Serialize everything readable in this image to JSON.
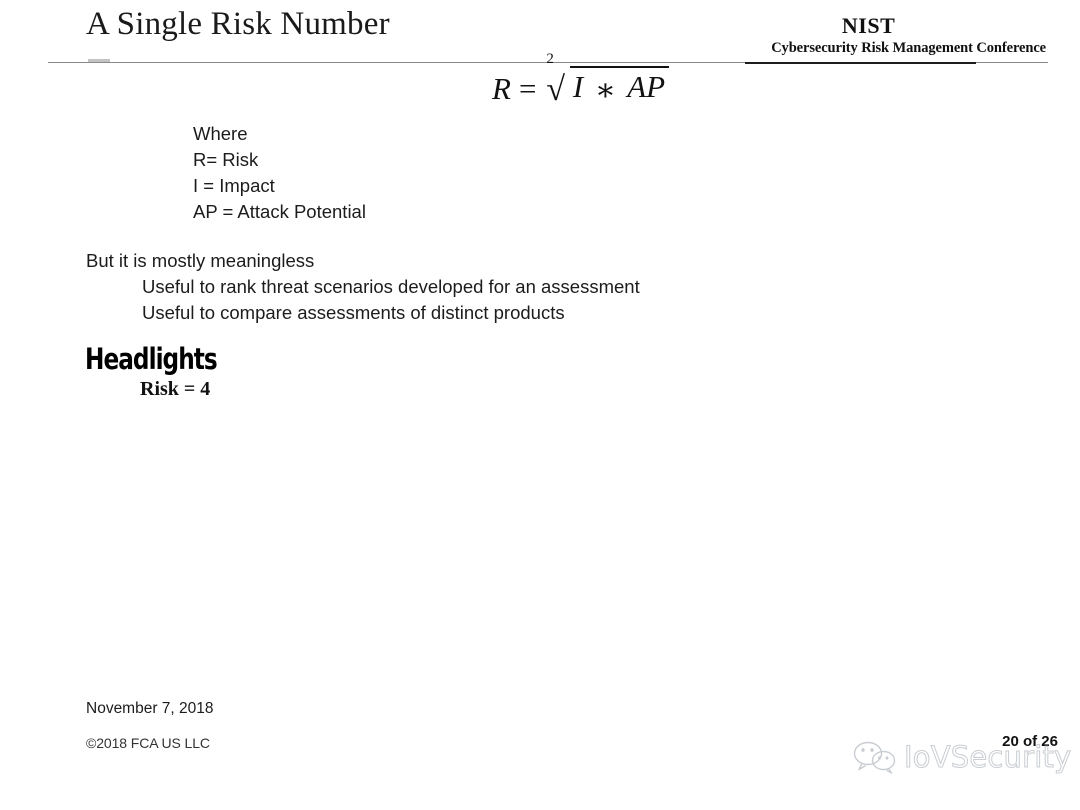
{
  "slide": {
    "title": "A Single Risk Number",
    "background_color": "#ffffff",
    "text_color": "#1c1c1c"
  },
  "header": {
    "organization": "NIST",
    "conference": "Cybersecurity Risk Management Conference",
    "rule_color": "#8a8a8a"
  },
  "formula": {
    "lhs": "R",
    "equals": "=",
    "root_index": "2",
    "radical_sign": "√",
    "radicand_first": "I",
    "operator": "∗",
    "radicand_second": "AP",
    "plain_text": "R = 2√(I * AP)"
  },
  "definitions": {
    "heading": "Where",
    "items": [
      "R= Risk",
      "I = Impact",
      "AP = Attack Potential"
    ]
  },
  "caveat": {
    "lead": "But it is mostly meaningless",
    "points": [
      "Useful to rank threat scenarios developed for an assessment",
      "Useful to compare assessments of distinct products"
    ]
  },
  "example": {
    "heading": "Headlights",
    "result": "Risk  = 4"
  },
  "footer": {
    "date": "November 7, 2018",
    "copyright": "©2018 FCA US LLC",
    "page_indicator": "20 of 26"
  },
  "watermark": {
    "label": "IoVSecurity",
    "icon": "wechat-icon",
    "color": "#c9cdd2"
  }
}
